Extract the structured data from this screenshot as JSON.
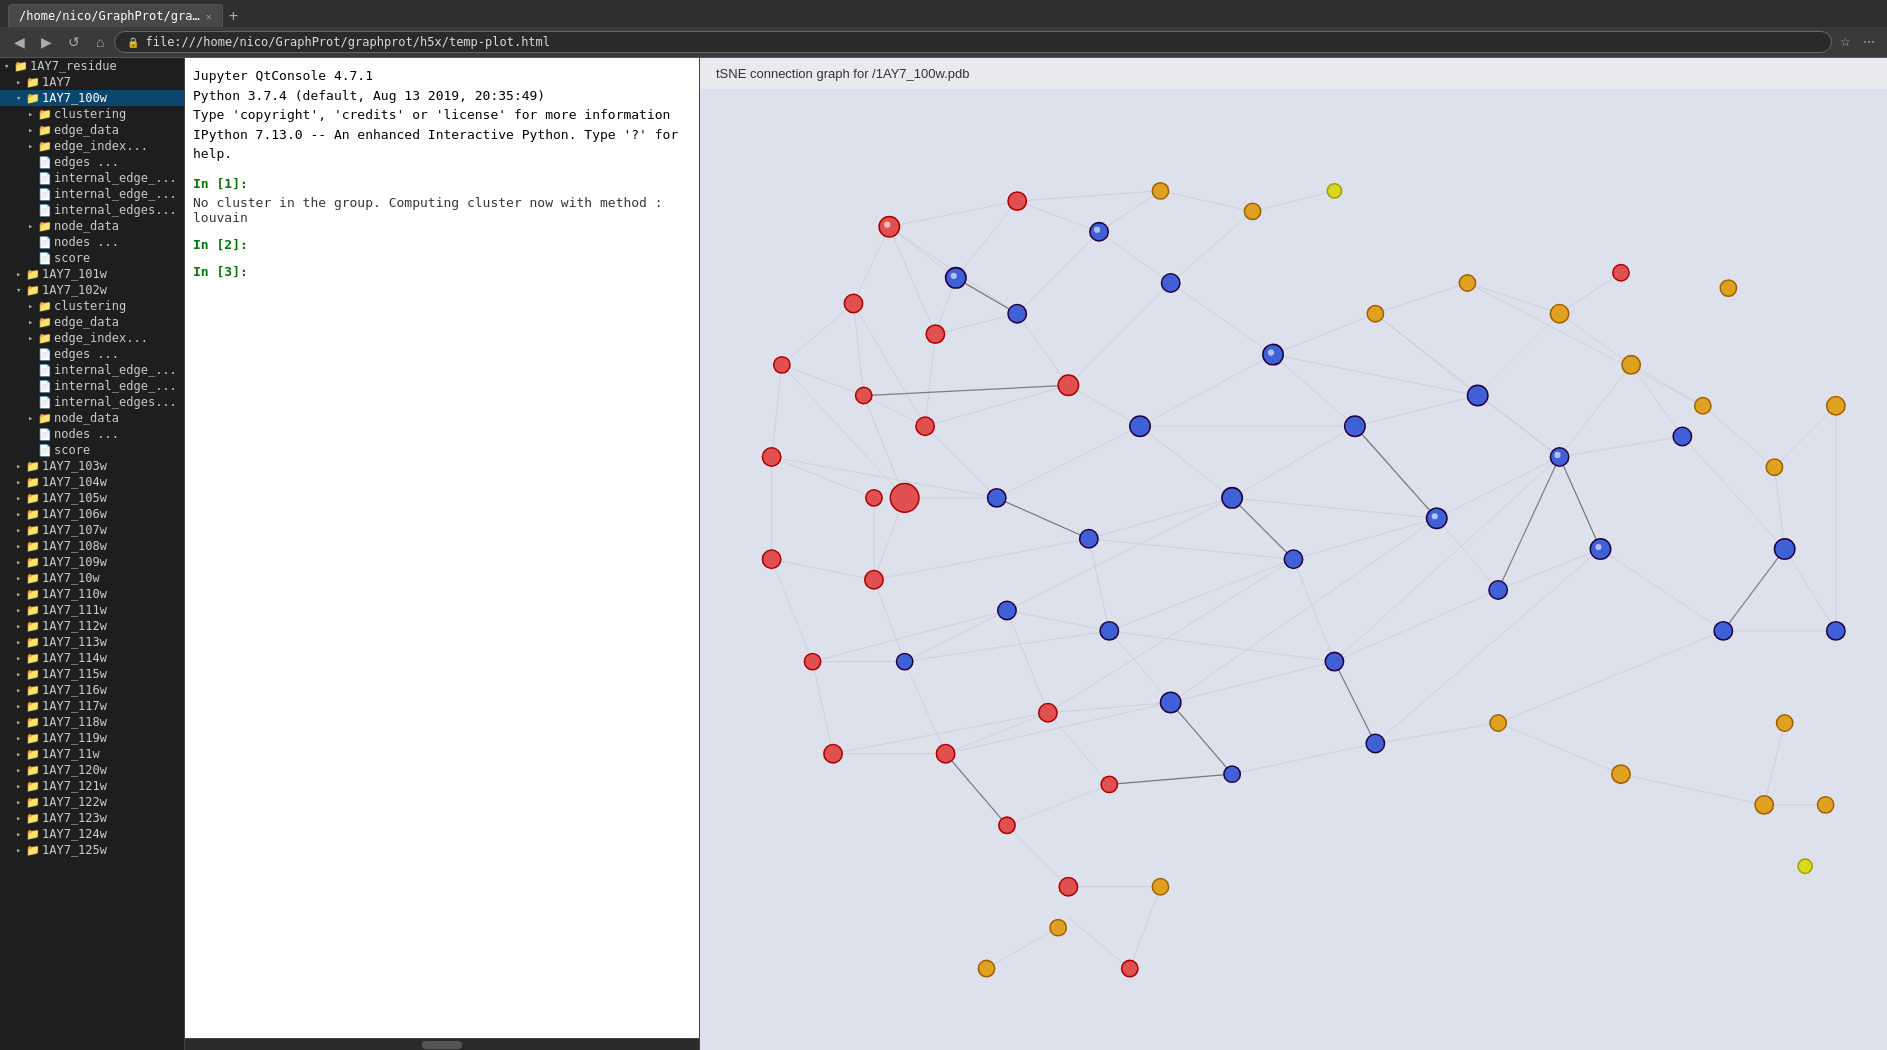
{
  "browser": {
    "tabs": [
      {
        "id": "tab1",
        "label": "/home/nico/GraphProt/gra…",
        "active": true
      },
      {
        "id": "tab2",
        "label": "+",
        "active": false
      }
    ],
    "url": "file:///home/nico/GraphProt/graphprot/h5x/temp-plot.html",
    "back_btn": "◀",
    "forward_btn": "▶",
    "refresh_btn": "↺",
    "home_btn": "⌂"
  },
  "graph_title": "tSNE connection graph for /1AY7_100w.pdb",
  "console": {
    "title": "Jupyter QtConsole 4.7.1",
    "python_info": "Python 3.7.4 (default, Aug 13 2019, 20:35:49)",
    "license_note": "Type 'copyright', 'credits' or 'license' for more information",
    "ipython_info": "IPython 7.13.0 -- An enhanced Interactive Python. Type '?' for help.",
    "cells": [
      {
        "prompt": "In [1]:",
        "output": "No cluster in the group. Computing cluster now with method : louvain"
      },
      {
        "prompt": "In [2]:",
        "output": ""
      },
      {
        "prompt": "In [3]:",
        "output": ""
      }
    ]
  },
  "file_tree": {
    "items": [
      {
        "level": 0,
        "expanded": true,
        "is_folder": true,
        "label": "1AY7_residue",
        "selected": false
      },
      {
        "level": 1,
        "expanded": false,
        "is_folder": true,
        "label": "1AY7",
        "selected": false
      },
      {
        "level": 1,
        "expanded": true,
        "is_folder": true,
        "label": "1AY7_100w",
        "selected": true
      },
      {
        "level": 2,
        "expanded": false,
        "is_folder": true,
        "label": "clustering",
        "selected": false
      },
      {
        "level": 2,
        "expanded": false,
        "is_folder": true,
        "label": "edge_data",
        "selected": false
      },
      {
        "level": 2,
        "expanded": false,
        "is_folder": true,
        "label": "edge_index...",
        "selected": false
      },
      {
        "level": 2,
        "expanded": false,
        "is_folder": false,
        "label": "edges  ...",
        "selected": false
      },
      {
        "level": 2,
        "expanded": false,
        "is_folder": false,
        "label": "internal_edge_...",
        "selected": false
      },
      {
        "level": 2,
        "expanded": false,
        "is_folder": false,
        "label": "internal_edge_...",
        "selected": false
      },
      {
        "level": 2,
        "expanded": false,
        "is_folder": false,
        "label": "internal_edges...",
        "selected": false
      },
      {
        "level": 2,
        "expanded": false,
        "is_folder": true,
        "label": "node_data",
        "selected": false
      },
      {
        "level": 2,
        "expanded": false,
        "is_folder": false,
        "label": "nodes  ...",
        "selected": false
      },
      {
        "level": 2,
        "expanded": false,
        "is_folder": false,
        "label": "score",
        "selected": false
      },
      {
        "level": 1,
        "expanded": false,
        "is_folder": true,
        "label": "1AY7_101w",
        "selected": false
      },
      {
        "level": 1,
        "expanded": true,
        "is_folder": true,
        "label": "1AY7_102w",
        "selected": false
      },
      {
        "level": 2,
        "expanded": false,
        "is_folder": true,
        "label": "clustering",
        "selected": false
      },
      {
        "level": 2,
        "expanded": false,
        "is_folder": true,
        "label": "edge_data",
        "selected": false
      },
      {
        "level": 2,
        "expanded": false,
        "is_folder": true,
        "label": "edge_index...",
        "selected": false
      },
      {
        "level": 2,
        "expanded": false,
        "is_folder": false,
        "label": "edges  ...",
        "selected": false
      },
      {
        "level": 2,
        "expanded": false,
        "is_folder": false,
        "label": "internal_edge_...",
        "selected": false
      },
      {
        "level": 2,
        "expanded": false,
        "is_folder": false,
        "label": "internal_edge_...",
        "selected": false
      },
      {
        "level": 2,
        "expanded": false,
        "is_folder": false,
        "label": "internal_edges...",
        "selected": false
      },
      {
        "level": 2,
        "expanded": false,
        "is_folder": true,
        "label": "node_data",
        "selected": false
      },
      {
        "level": 2,
        "expanded": false,
        "is_folder": false,
        "label": "nodes  ...",
        "selected": false
      },
      {
        "level": 2,
        "expanded": false,
        "is_folder": false,
        "label": "score",
        "selected": false
      },
      {
        "level": 1,
        "expanded": false,
        "is_folder": true,
        "label": "1AY7_103w",
        "selected": false
      },
      {
        "level": 1,
        "expanded": false,
        "is_folder": true,
        "label": "1AY7_104w",
        "selected": false
      },
      {
        "level": 1,
        "expanded": false,
        "is_folder": true,
        "label": "1AY7_105w",
        "selected": false
      },
      {
        "level": 1,
        "expanded": false,
        "is_folder": true,
        "label": "1AY7_106w",
        "selected": false
      },
      {
        "level": 1,
        "expanded": false,
        "is_folder": true,
        "label": "1AY7_107w",
        "selected": false
      },
      {
        "level": 1,
        "expanded": false,
        "is_folder": true,
        "label": "1AY7_108w",
        "selected": false
      },
      {
        "level": 1,
        "expanded": false,
        "is_folder": true,
        "label": "1AY7_109w",
        "selected": false
      },
      {
        "level": 1,
        "expanded": false,
        "is_folder": true,
        "label": "1AY7_10w",
        "selected": false
      },
      {
        "level": 1,
        "expanded": false,
        "is_folder": true,
        "label": "1AY7_110w",
        "selected": false
      },
      {
        "level": 1,
        "expanded": false,
        "is_folder": true,
        "label": "1AY7_111w",
        "selected": false
      },
      {
        "level": 1,
        "expanded": false,
        "is_folder": true,
        "label": "1AY7_112w",
        "selected": false
      },
      {
        "level": 1,
        "expanded": false,
        "is_folder": true,
        "label": "1AY7_113w",
        "selected": false
      },
      {
        "level": 1,
        "expanded": false,
        "is_folder": true,
        "label": "1AY7_114w",
        "selected": false
      },
      {
        "level": 1,
        "expanded": false,
        "is_folder": true,
        "label": "1AY7_115w",
        "selected": false
      },
      {
        "level": 1,
        "expanded": false,
        "is_folder": true,
        "label": "1AY7_116w",
        "selected": false
      },
      {
        "level": 1,
        "expanded": false,
        "is_folder": true,
        "label": "1AY7_117w",
        "selected": false
      },
      {
        "level": 1,
        "expanded": false,
        "is_folder": true,
        "label": "1AY7_118w",
        "selected": false
      },
      {
        "level": 1,
        "expanded": false,
        "is_folder": true,
        "label": "1AY7_119w",
        "selected": false
      },
      {
        "level": 1,
        "expanded": false,
        "is_folder": true,
        "label": "1AY7_11w",
        "selected": false
      },
      {
        "level": 1,
        "expanded": false,
        "is_folder": true,
        "label": "1AY7_120w",
        "selected": false
      },
      {
        "level": 1,
        "expanded": false,
        "is_folder": true,
        "label": "1AY7_121w",
        "selected": false
      },
      {
        "level": 1,
        "expanded": false,
        "is_folder": true,
        "label": "1AY7_122w",
        "selected": false
      },
      {
        "level": 1,
        "expanded": false,
        "is_folder": true,
        "label": "1AY7_123w",
        "selected": false
      },
      {
        "level": 1,
        "expanded": false,
        "is_folder": true,
        "label": "1AY7_124w",
        "selected": false
      },
      {
        "level": 1,
        "expanded": false,
        "is_folder": true,
        "label": "1AY7_125w",
        "selected": false
      }
    ]
  }
}
